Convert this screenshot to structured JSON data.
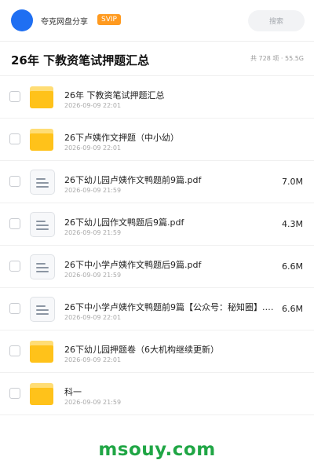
{
  "topbar": {
    "avatar_color": "#1f6ff2",
    "share_title": "夸克网盘分享",
    "vip_badge": "SVIP",
    "search_label": "搜索"
  },
  "folder": {
    "title": "26年 下教资笔试押题汇总",
    "meta": "共 728 项 · 55.5G"
  },
  "files": [
    {
      "type": "folder",
      "icon": "folder-icon",
      "name": "26年 下教资笔试押题汇总",
      "date": "2026-09-09 22:01",
      "size": ""
    },
    {
      "type": "folder",
      "icon": "folder-icon",
      "name": "26下卢姨作文押题（中小幼）",
      "date": "2026-09-09 22:01",
      "size": ""
    },
    {
      "type": "file",
      "icon": "document-icon",
      "name": "26下幼儿园卢姨作文鸭题前9篇.pdf",
      "date": "2026-09-09 21:59",
      "size": "7.0M"
    },
    {
      "type": "file",
      "icon": "document-icon",
      "name": "26下幼儿园作文鸭题后9篇.pdf",
      "date": "2026-09-09 21:59",
      "size": "4.3M"
    },
    {
      "type": "file",
      "icon": "document-icon",
      "name": "26下中小学卢姨作文鸭题后9篇.pdf",
      "date": "2026-09-09 21:59",
      "size": "6.6M"
    },
    {
      "type": "file",
      "icon": "document-icon",
      "name": "26下中小学卢姨作文鸭题前9篇【公众号：秘知圈】.pdf",
      "date": "2026-09-09 22:01",
      "size": "6.6M"
    },
    {
      "type": "folder",
      "icon": "folder-icon",
      "name": "26下幼儿园押题卷（6大机构继续更新）",
      "date": "2026-09-09 22:01",
      "size": ""
    },
    {
      "type": "folder",
      "icon": "folder-icon",
      "name": "科一",
      "date": "2026-09-09 21:59",
      "size": ""
    }
  ],
  "watermark": "msouy.com",
  "colors": {
    "accent_blue": "#1f6ff2",
    "vip_orange": "#ff9a1f",
    "folder_yellow": "#ffc21a",
    "watermark_green": "#20a645"
  }
}
